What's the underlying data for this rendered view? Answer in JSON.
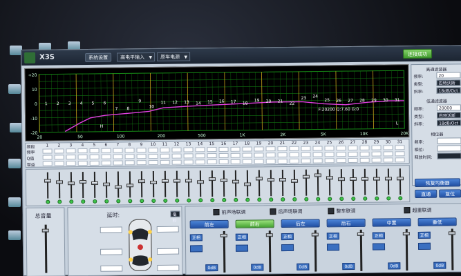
{
  "titlebar": {
    "app_name": "X3S",
    "system_settings": "系统设置",
    "input_mode": "高电平输入",
    "mode_drop": "原车电源",
    "connect_label": "连接成功"
  },
  "graph": {
    "y_labels": [
      "+20",
      "10",
      "0",
      "-10",
      "-20"
    ],
    "x_labels": [
      "20",
      "50",
      "100",
      "200",
      "500",
      "1K",
      "2K",
      "5K",
      "10K",
      "20K"
    ],
    "points": [
      "1",
      "2",
      "3",
      "4",
      "5",
      "6",
      "7",
      "8",
      "9",
      "10",
      "11",
      "12",
      "13",
      "14",
      "15",
      "16",
      "17",
      "18",
      "19",
      "20",
      "21",
      "22",
      "23",
      "24",
      "25",
      "26",
      "27",
      "28",
      "29",
      "30",
      "31"
    ],
    "readout": "F:20200 Q:7.60 G:0",
    "marker_h": "H",
    "marker_l": "L",
    "line_color": "#e040e0"
  },
  "filters": {
    "high_pass_title": "高通滤波器",
    "low_pass_title": "低通滤波器",
    "phase_title": "相位器",
    "freq_label": "频率:",
    "type_label": "类型:",
    "slope_label": "斜率:",
    "hp_freq": "20",
    "hp_type": "巴特沃斯",
    "hp_slope": "18dB/Oct",
    "lp_freq": "20000",
    "lp_type": "巴特沃斯",
    "lp_slope": "18dB/Oct",
    "phase_freq_label": "频率:",
    "phase_val_label": "相位:",
    "release_label": "释放时间:"
  },
  "channels": {
    "row_labels": [
      "频段",
      "频率",
      "Q值",
      "增益"
    ],
    "numbers": [
      "1",
      "2",
      "3",
      "4",
      "5",
      "6",
      "7",
      "8",
      "9",
      "10",
      "11",
      "12",
      "13",
      "14",
      "15",
      "16",
      "17",
      "18",
      "19",
      "20",
      "21",
      "22",
      "23",
      "24",
      "25",
      "26",
      "27",
      "28",
      "29",
      "30",
      "31"
    ]
  },
  "right_buttons": {
    "restore_eq": "恢复均衡器",
    "direct": "直通",
    "reset": "复位"
  },
  "master": {
    "title": "总音量"
  },
  "delay": {
    "title": "延时:",
    "unit": "毫秒"
  },
  "link": {
    "front_link": "前声场联调",
    "rear_link": "后声场联调",
    "whole_link": "整车联调",
    "sub_link": "超重联调",
    "channels": [
      "前左",
      "前右",
      "后左",
      "后右",
      "中置",
      "重低"
    ],
    "phase_label": "正相",
    "db_label": "0dB"
  }
}
